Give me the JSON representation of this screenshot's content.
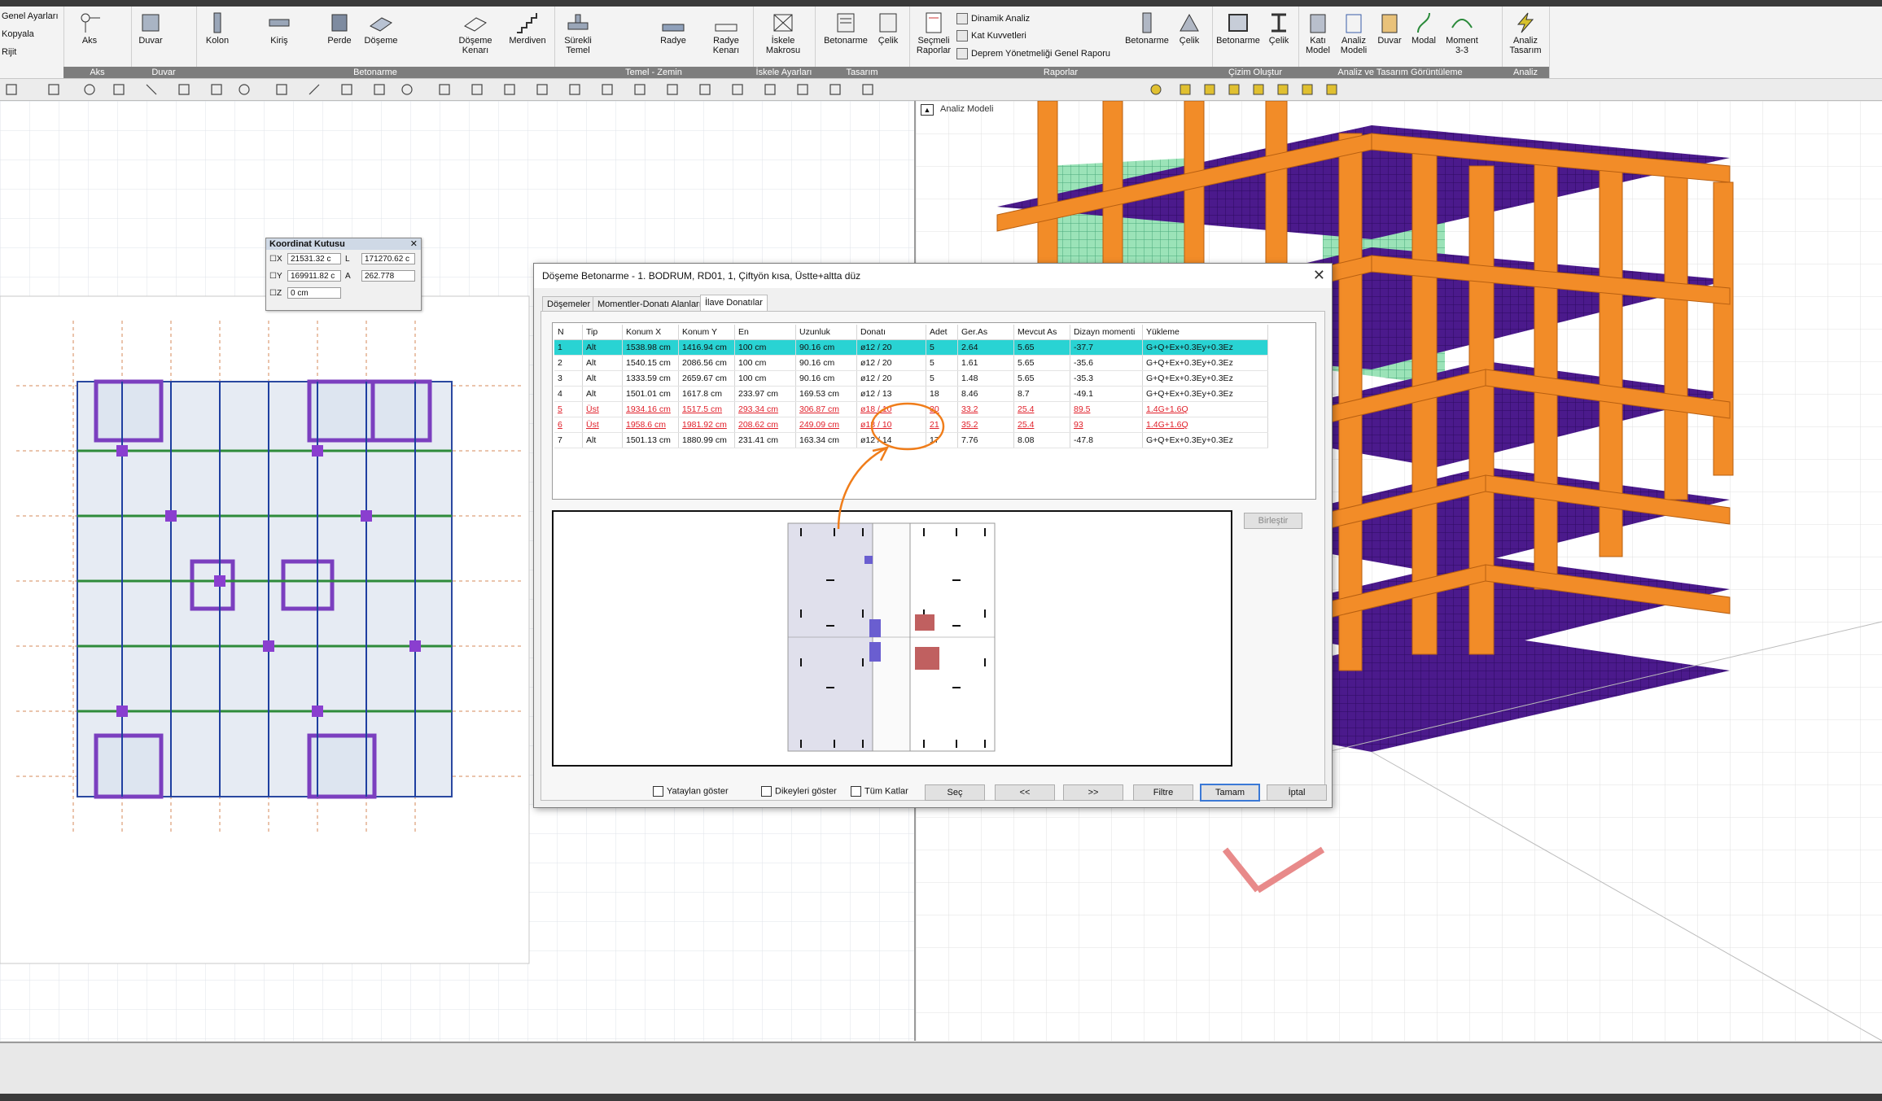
{
  "ribbon": {
    "settings": {
      "general": "Genel Ayarları",
      "copy": "Kopyala",
      "rigid": "Rijit"
    },
    "groups": [
      "Aks",
      "Duvar",
      "Betonarme",
      "Temel - Zemin",
      "İskele Ayarları",
      "Tasarım",
      "Raporlar",
      "Çizim Oluştur",
      "Analiz ve Tasarım Görüntüleme",
      "Analiz"
    ],
    "buttons": {
      "aks": "Aks",
      "duvar": "Duvar",
      "kolon": "Kolon",
      "kiris": "Kiriş",
      "perde": "Perde",
      "doseme": "Döşeme",
      "doseme_kenari": "Döşeme Kenarı",
      "merdiven": "Merdiven",
      "surekli_temel": "Sürekli Temel",
      "radye": "Radye",
      "radye_kenari": "Radye Kenarı",
      "iskele_makrosu": "İskele Makrosu",
      "betonarme": "Betonarme",
      "celik": "Çelik",
      "secmeli_raporlar": "Seçmeli Raporlar",
      "dinamik_analiz": "Dinamik Analiz",
      "kat_kuvvetleri": "Kat Kuvvetleri",
      "deprem_raporu": "Deprem Yönetmeliği Genel Raporu",
      "betonarme2": "Betonarme",
      "celik2": "Çelik",
      "betonarme3": "Betonarme",
      "celik3": "Çelik",
      "kati_model": "Katı Model",
      "analiz_modeli": "Analiz Modeli",
      "duvar2": "Duvar",
      "modal": "Modal",
      "moment": "Moment 3-3",
      "analiz_tasarim": "Analiz Tasarım"
    }
  },
  "coord_box": {
    "title": "Koordinat Kutusu",
    "x_label": "X",
    "x_value": "21531.32 c",
    "y_label": "Y",
    "y_value": "169911.82 c",
    "z_label": "Z",
    "z_value": "0 cm",
    "l_label": "L",
    "l_value": "171270.62 c",
    "a_label": "A",
    "a_value": "262.778"
  },
  "model_view": {
    "title": "Analiz Modeli"
  },
  "dialog": {
    "title": "Döşeme Betonarme - 1. BODRUM, RD01, 1, Çiftyön kısa, Üstte+altta düz",
    "tabs": [
      "Döşemeler",
      "Momentler-Donatı Alanları",
      "İlave Donatılar"
    ],
    "active_tab": 2,
    "columns": [
      "N",
      "Tip",
      "Konum X",
      "Konum Y",
      "En",
      "Uzunluk",
      "Donatı",
      "Adet",
      "Ger.As",
      "Mevcut As",
      "Dizayn momenti",
      "Yükleme"
    ],
    "rows": [
      [
        "1",
        "Alt",
        "1538.98 cm",
        "1416.94 cm",
        "100 cm",
        "90.16 cm",
        "ø12 / 20",
        "5",
        "2.64",
        "5.65",
        "-37.7",
        "G+Q+Ex+0.3Ey+0.3Ez"
      ],
      [
        "2",
        "Alt",
        "1540.15 cm",
        "2086.56 cm",
        "100 cm",
        "90.16 cm",
        "ø12 / 20",
        "5",
        "1.61",
        "5.65",
        "-35.6",
        "G+Q+Ex+0.3Ey+0.3Ez"
      ],
      [
        "3",
        "Alt",
        "1333.59 cm",
        "2659.67 cm",
        "100 cm",
        "90.16 cm",
        "ø12 / 20",
        "5",
        "1.48",
        "5.65",
        "-35.3",
        "G+Q+Ex+0.3Ey+0.3Ez"
      ],
      [
        "4",
        "Alt",
        "1501.01 cm",
        "1617.8 cm",
        "233.97 cm",
        "169.53 cm",
        "ø12 / 13",
        "18",
        "8.46",
        "8.7",
        "-49.1",
        "G+Q+Ex+0.3Ey+0.3Ez"
      ],
      [
        "5",
        "Üst",
        "1934.16 cm",
        "1517.5 cm",
        "293.34 cm",
        "306.87 cm",
        "ø18 / 10",
        "30",
        "33.2",
        "25.4",
        "89.5",
        "1.4G+1.6Q"
      ],
      [
        "6",
        "Üst",
        "1958.6 cm",
        "1981.92 cm",
        "208.62 cm",
        "249.09 cm",
        "ø18 / 10",
        "21",
        "35.2",
        "25.4",
        "93",
        "1.4G+1.6Q"
      ],
      [
        "7",
        "Alt",
        "1501.13 cm",
        "1880.99 cm",
        "231.41 cm",
        "163.34 cm",
        "ø12 / 14",
        "17",
        "7.76",
        "8.08",
        "-47.8",
        "G+Q+Ex+0.3Ey+0.3Ez"
      ]
    ],
    "selected_row": 0,
    "warning_rows": [
      4,
      5
    ],
    "buttons": {
      "merge": "Birleştir",
      "select": "Seç",
      "prev": "<<",
      "next": ">>",
      "filter": "Filtre",
      "ok": "Tamam",
      "cancel": "İptal"
    },
    "checkboxes": {
      "horizontal": "Yataylan göster",
      "vertical": "Dikeyleri göster",
      "all_floors": "Tüm Katlar"
    }
  },
  "colors": {
    "selected_row": "#29d3d3",
    "warning": "#e0202a",
    "annotation": "#f07d1a",
    "column_orange": "#f28c28",
    "slab_purple": "#4b1a8c",
    "wall_green": "#9be3b8"
  }
}
